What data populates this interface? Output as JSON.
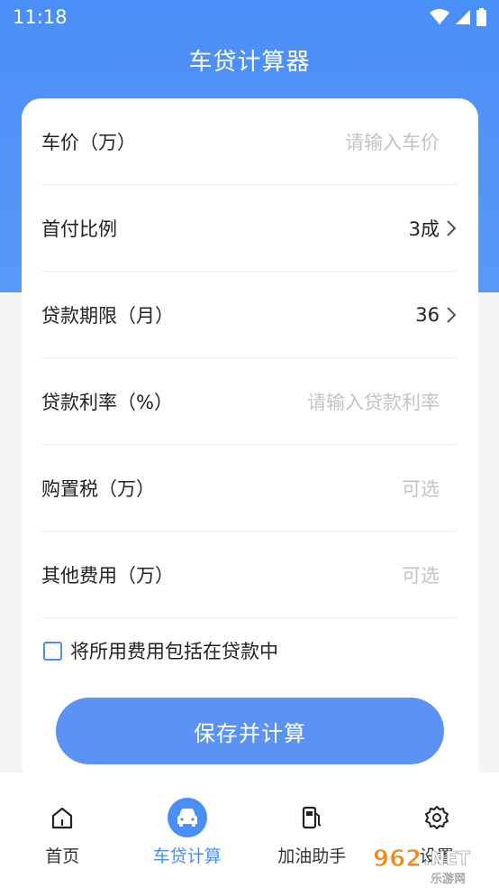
{
  "status_bar": {
    "time": "11:18"
  },
  "header": {
    "title": "车贷计算器"
  },
  "form": {
    "rows": [
      {
        "label": "车价（万）",
        "placeholder": "请输入车价",
        "value": ""
      },
      {
        "label": "首付比例",
        "placeholder": "",
        "value": "3成"
      },
      {
        "label": "贷款期限（月）",
        "placeholder": "",
        "value": "36"
      },
      {
        "label": "贷款利率（%）",
        "placeholder": "请输入贷款利率",
        "value": ""
      },
      {
        "label": "购置税（万）",
        "placeholder": "可选",
        "value": ""
      },
      {
        "label": "其他费用（万）",
        "placeholder": "可选",
        "value": ""
      }
    ],
    "include_fees": {
      "label": "将所用费用包括在贷款中",
      "checked": false
    },
    "save_button": "保存并计算"
  },
  "tabbar": {
    "tabs": [
      {
        "label": "首页",
        "icon": "home-icon",
        "active": false
      },
      {
        "label": "车贷计算",
        "icon": "car-icon",
        "active": true
      },
      {
        "label": "加油助手",
        "icon": "fuel-pump-icon",
        "active": false
      },
      {
        "label": "设置",
        "icon": "gear-icon",
        "active": false
      }
    ]
  },
  "watermark": {
    "text": "962.NET",
    "subtext": "乐游网"
  },
  "colors": {
    "accent": "#4a8ef7",
    "button": "#5b93f5",
    "placeholder": "#c4c4c4"
  }
}
